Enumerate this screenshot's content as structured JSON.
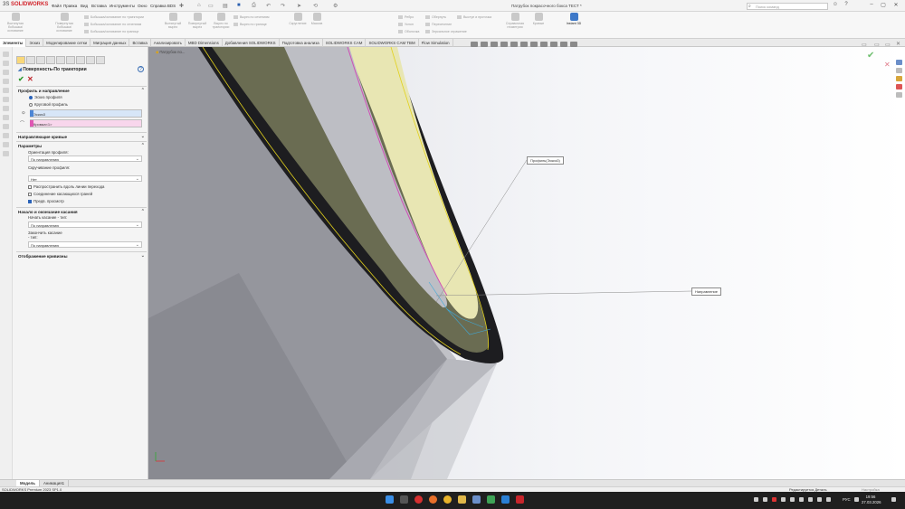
{
  "app": {
    "brand": "SOLIDWORKS",
    "menu": [
      "Файл",
      "Правка",
      "Вид",
      "Вставка",
      "Инструменты",
      "Окно",
      "Справка BDS"
    ],
    "doc_title": "Патрубок покрасочного бокса ТЕСТ *",
    "search_placeholder": "Поиск команд"
  },
  "ribbon": {
    "buttons": [
      {
        "label": "Вытянутая бобышка/основание",
        "active": false
      },
      {
        "label": "Повернутая бобышка/основание",
        "active": false
      },
      {
        "label": "Вытянутый вырез",
        "active": false
      },
      {
        "label": "Повернутый вырез",
        "active": false
      },
      {
        "label": "Вырез по траектории",
        "active": false
      },
      {
        "label": "Скругление",
        "active": false
      },
      {
        "label": "Массив",
        "active": false
      },
      {
        "label": "Ребро",
        "active": false
      },
      {
        "label": "Уклон",
        "active": false
      },
      {
        "label": "Оболочка",
        "active": false
      },
      {
        "label": "Справочная геометрия",
        "active": false
      },
      {
        "label": "Кривые",
        "active": false
      },
      {
        "label": "Instant 3D",
        "active": true
      }
    ],
    "small_items": [
      "Бобышка/основание по траектории",
      "Бобышка/основание по сечениям",
      "Бобышка/основание по границе",
      "Вырез по сечениям",
      "Вырез по границе",
      "Обернуть",
      "Пересечение",
      "Зеркальное отражение",
      "Выступ и проточка"
    ]
  },
  "tabs": [
    "Элементы",
    "Эскиз",
    "Моделирование сетки",
    "Миграция данных",
    "Вставка",
    "Анализировать",
    "MBD Dimensions",
    "Добавления SOLIDWORKS",
    "Подготовка анализа",
    "SOLIDWORKS CAM",
    "SOLIDWORKS CAM TBM",
    "Flow Simulation"
  ],
  "active_tab": "Элементы",
  "property_manager": {
    "title": "Поверхность-По траектории",
    "sections": {
      "profile_path": "Профиль и направление",
      "guide_curves": "Направляющие кривые",
      "params": "Параметры",
      "start_end": "Начало и окончание касания",
      "curvature": "Отображение кривизны"
    },
    "profile_options": [
      "Эскиз профиля",
      "Круговой профиль"
    ],
    "selected_profile_option": "Эскиз профиля",
    "profile_field": "Эскиз3",
    "path_field": "Кромка<1>",
    "orientation": {
      "label": "Ориентация профиля:",
      "value": "По направлению"
    },
    "twist": {
      "label": "Скручивание профиля:",
      "value": "Нет"
    },
    "checkboxes": [
      {
        "label": "Распространить вдоль линии перехода",
        "checked": false
      },
      {
        "label": "Соединение касающихся граней",
        "checked": false
      },
      {
        "label": "Предв. просмотр",
        "checked": true
      }
    ],
    "start_tangent": {
      "label": "Начать касание - тип:",
      "value": "По направлению"
    },
    "end_tangent": {
      "label": "Закончить касание - тип:",
      "value": "По направлению"
    }
  },
  "viewport": {
    "tree_item": "Патрубок по...",
    "callouts": {
      "profile": "Профиль(Эскиз3)",
      "path": "Направление"
    }
  },
  "bottom_tabs": [
    "Модель",
    "Анимация1"
  ],
  "active_bottom_tab": "Модель",
  "status": {
    "left": "SOLIDWORKS Premium 2023 SP1.0",
    "mode": "Редактируется Деталь",
    "custom": "Настройка"
  },
  "taskbar": {
    "lang": "РУС",
    "time": "19:56",
    "date": "27.03.2026",
    "apps": [
      "windows-start",
      "search",
      "yandex",
      "firefox",
      "chrome",
      "explorer",
      "files",
      "solidworks-tools",
      "edge",
      "solidworks"
    ]
  }
}
